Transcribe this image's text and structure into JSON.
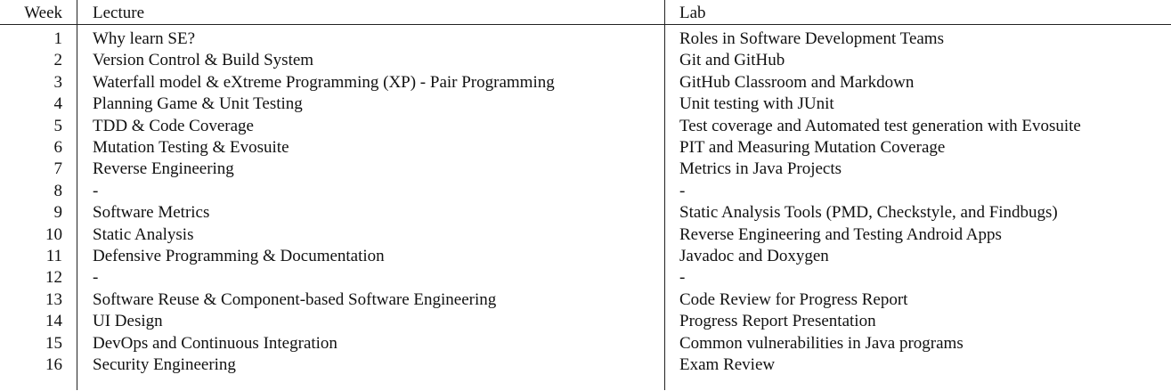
{
  "table": {
    "headers": {
      "week": "Week",
      "lecture": "Lecture",
      "lab": "Lab"
    },
    "rows": [
      {
        "week": "1",
        "lecture": "Why learn SE?",
        "lab": "Roles in Software Development Teams"
      },
      {
        "week": "2",
        "lecture": "Version Control & Build System",
        "lab": "Git and GitHub"
      },
      {
        "week": "3",
        "lecture": "Waterfall model & eXtreme Programming (XP) - Pair Programming",
        "lab": "GitHub Classroom and Markdown"
      },
      {
        "week": "4",
        "lecture": "Planning Game & Unit Testing",
        "lab": "Unit testing with JUnit"
      },
      {
        "week": "5",
        "lecture": "TDD & Code Coverage",
        "lab": "Test coverage and Automated test generation with Evosuite"
      },
      {
        "week": "6",
        "lecture": "Mutation Testing & Evosuite",
        "lab": "PIT and Measuring Mutation Coverage"
      },
      {
        "week": "7",
        "lecture": "Reverse Engineering",
        "lab": "Metrics in Java Projects"
      },
      {
        "week": "8",
        "lecture": "-",
        "lab": "-"
      },
      {
        "week": "9",
        "lecture": "Software Metrics",
        "lab": "Static Analysis Tools (PMD, Checkstyle, and Findbugs)"
      },
      {
        "week": "10",
        "lecture": "Static Analysis",
        "lab": "Reverse Engineering and Testing Android Apps"
      },
      {
        "week": "11",
        "lecture": "Defensive Programming & Documentation",
        "lab": "Javadoc and Doxygen"
      },
      {
        "week": "12",
        "lecture": "-",
        "lab": "-"
      },
      {
        "week": "13",
        "lecture": "Software Reuse & Component-based Software Engineering",
        "lab": "Code Review for Progress Report"
      },
      {
        "week": "14",
        "lecture": "UI Design",
        "lab": "Progress Report Presentation"
      },
      {
        "week": "15",
        "lecture": "DevOps and Continuous Integration",
        "lab": "Common vulnerabilities in Java programs"
      },
      {
        "week": "16",
        "lecture": "Security Engineering",
        "lab": "Exam Review"
      }
    ]
  }
}
